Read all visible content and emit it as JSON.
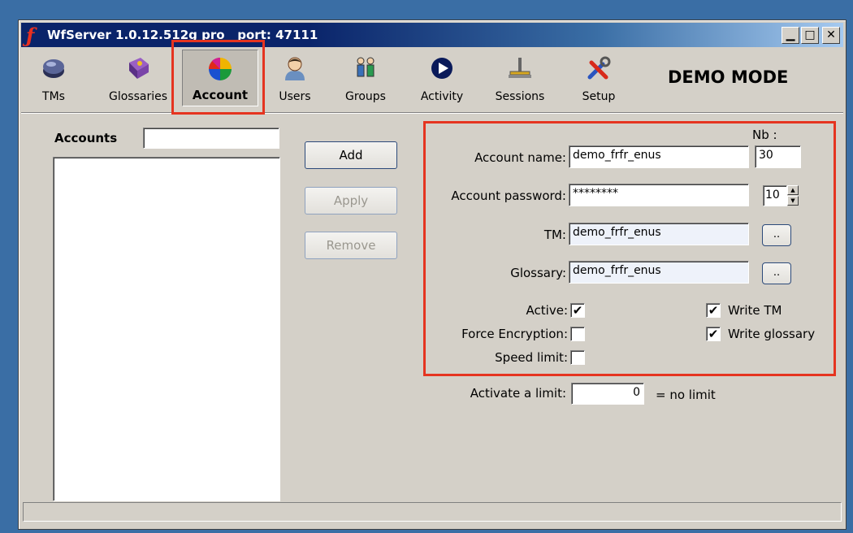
{
  "window": {
    "title": "WfServer 1.0.12.512g pro   port: 47111",
    "minimize_glyph": "▁",
    "maximize_glyph": "□",
    "close_glyph": "✕"
  },
  "toolbar": {
    "items": [
      {
        "label": "TMs",
        "icon": "tm-database-icon"
      },
      {
        "label": "Glossaries",
        "icon": "glossary-book-icon"
      },
      {
        "label": "Account",
        "icon": "color-wheel-icon",
        "active": true
      },
      {
        "label": "Users",
        "icon": "user-icon"
      },
      {
        "label": "Groups",
        "icon": "group-icon"
      },
      {
        "label": "Activity",
        "icon": "play-circle-icon"
      },
      {
        "label": "Sessions",
        "icon": "sessions-icon"
      },
      {
        "label": "Setup",
        "icon": "tools-icon"
      }
    ],
    "mode_label": "DEMO MODE"
  },
  "accounts": {
    "label": "Accounts",
    "filter_value": ""
  },
  "buttons": {
    "add": "Add",
    "apply": "Apply",
    "remove": "Remove",
    "browse_tm": "..",
    "browse_glossary": ".."
  },
  "form": {
    "nb_label": "Nb :",
    "nb_value": "30",
    "account_name_label": "Account name:",
    "account_name_value": "demo_frfr_enus",
    "account_password_label": "Account password:",
    "account_password_value": "********",
    "spin_value": "10",
    "tm_label": "TM:",
    "tm_value": "demo_frfr_enus",
    "glossary_label": "Glossary:",
    "glossary_value": "demo_frfr_enus",
    "active_label": "Active:",
    "active_checked": true,
    "force_encryption_label": "Force Encryption:",
    "force_encryption_checked": false,
    "speed_limit_label": "Speed limit:",
    "speed_limit_checked": false,
    "write_tm_label": "Write TM",
    "write_tm_checked": true,
    "write_glossary_label": "Write glossary",
    "write_glossary_checked": true,
    "activate_limit_label": "Activate a limit:",
    "activate_limit_value": "0",
    "no_limit_label": "= no limit",
    "check_glyph": "✔"
  },
  "colors": {
    "highlight": "#e53420",
    "titlebar": "#0a246a",
    "window_bg": "#d4d0c8"
  }
}
